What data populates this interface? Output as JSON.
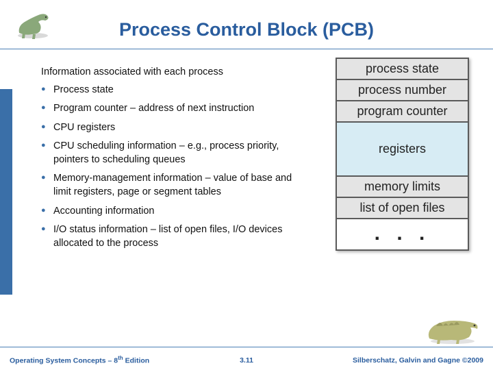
{
  "title": "Process Control Block (PCB)",
  "intro": "Information associated with each process",
  "bullets": [
    "Process state",
    "Program counter – address of next instruction",
    "CPU registers",
    "CPU scheduling information – e.g., process priority, pointers to scheduling queues",
    "Memory-management information – value of base and limit registers, page or segment tables",
    "Accounting information",
    "I/O status information – list of open files, I/O devices allocated to the process"
  ],
  "pcb_rows": {
    "r0": "process state",
    "r1": "process number",
    "r2": "program counter",
    "r3": "registers",
    "r4": "memory limits",
    "r5": "list of open files",
    "r6": ". . ."
  },
  "footer": {
    "book": "Operating System Concepts – 8",
    "ed_sup": "th",
    "ed_suffix": " Edition",
    "page": "3.11",
    "copyright": "Silberschatz, Galvin and Gagne ©2009"
  }
}
